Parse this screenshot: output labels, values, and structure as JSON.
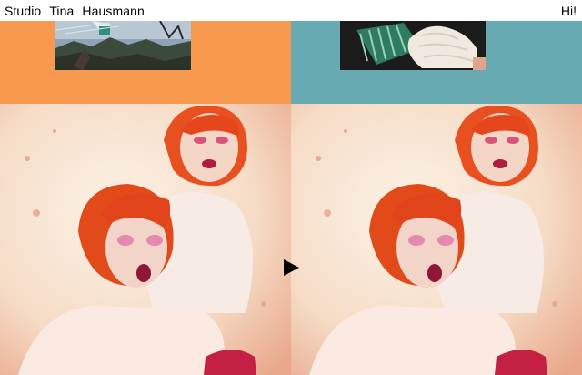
{
  "header": {
    "brand_words": [
      "Studio",
      "Tina",
      "Hausmann"
    ],
    "greeting": "Hi!"
  },
  "tiles": {
    "left_color": "#f89950",
    "right_color": "#67aab1"
  },
  "video": {
    "play_icon": "play-icon"
  }
}
